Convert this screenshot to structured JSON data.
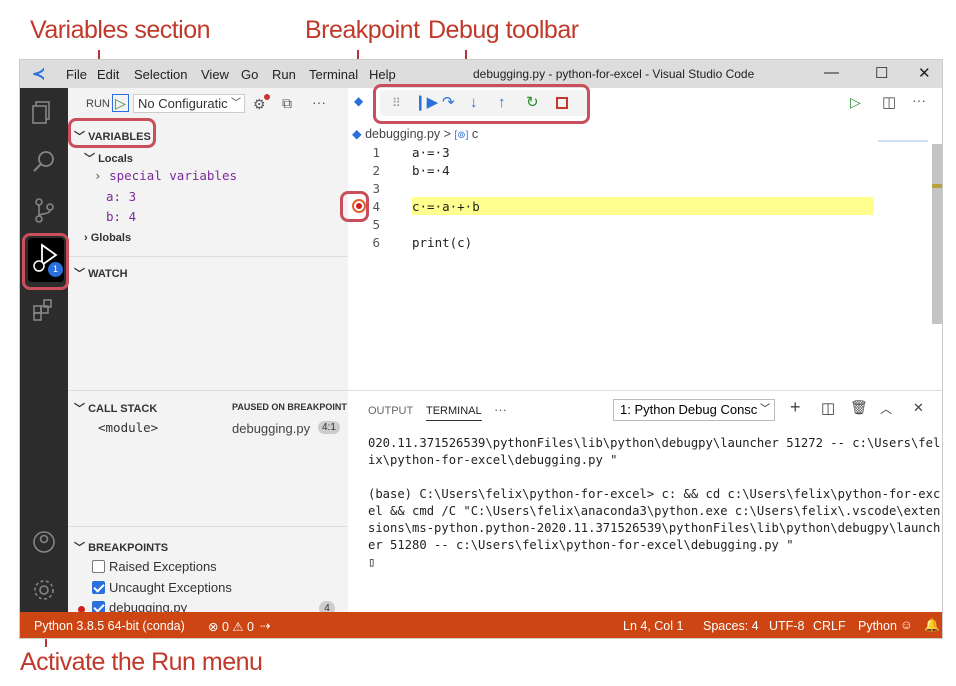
{
  "callouts": {
    "variables_section": "Variables section",
    "breakpoint": "Breakpoint",
    "debug_toolbar": "Debug toolbar",
    "activate_run": "Activate the Run menu"
  },
  "colors": {
    "accent": "#c9505a",
    "status_bar": "#cc4512",
    "highlight": "#ffff8f"
  },
  "titlebar": {
    "menu": [
      "File",
      "Edit",
      "Selection",
      "View",
      "Go",
      "Run",
      "Terminal",
      "Help"
    ],
    "title": "debugging.py - python-for-excel - Visual Studio Code",
    "minimize": "—",
    "maximize": "☐",
    "close": "✕"
  },
  "sidebar": {
    "run_label": "RUN",
    "config": "No Configuratic",
    "variables_header": "VARIABLES",
    "locals": "Locals",
    "special_variables": "special variables",
    "var_a": "a: 3",
    "var_b": "b: 4",
    "globals": "Globals",
    "watch_header": "WATCH",
    "call_stack_header": "CALL STACK",
    "paused": "PAUSED ON BREAKPOINT",
    "module": "<module>",
    "frame_file": "debugging.py",
    "frame_pos": "4:1",
    "breakpoints_header": "BREAKPOINTS",
    "bp_raised": "Raised Exceptions",
    "bp_uncaught": "Uncaught Exceptions",
    "bp_file": "debugging.py",
    "bp_count": "4",
    "debug_badge": "1"
  },
  "editor": {
    "breadcrumb_file": "debugging.py",
    "breadcrumb_sep": ">",
    "breadcrumb_symbol": "c",
    "lines": [
      {
        "num": "1",
        "code": "a·=·3"
      },
      {
        "num": "2",
        "code": "b·=·4"
      },
      {
        "num": "3",
        "code": ""
      },
      {
        "num": "4",
        "code": "c·=·a·+·b"
      },
      {
        "num": "5",
        "code": ""
      },
      {
        "num": "6",
        "code": "print(c)"
      }
    ]
  },
  "panel": {
    "tab_output": "OUTPUT",
    "tab_terminal": "TERMINAL",
    "more": "···",
    "terminal_select": "1: Python Debug Consc",
    "terminal_lines": [
      "020.11.371526539\\pythonFiles\\lib\\python\\debugpy\\launcher 51272 -- c:\\Users\\fel",
      "ix\\python-for-excel\\debugging.py \"",
      "",
      "(base) C:\\Users\\felix\\python-for-excel> c: && cd c:\\Users\\felix\\python-for-exc",
      "el && cmd /C \"C:\\Users\\felix\\anaconda3\\python.exe c:\\Users\\felix\\.vscode\\exten",
      "sions\\ms-python.python-2020.11.371526539\\pythonFiles\\lib\\python\\debugpy\\launch",
      "er 51280 -- c:\\Users\\felix\\python-for-excel\\debugging.py \"",
      "▯"
    ]
  },
  "statusbar": {
    "python": "Python 3.8.5 64-bit (conda)",
    "problems": "⊗ 0 ⚠ 0",
    "position": "Ln 4, Col 1",
    "spaces": "Spaces: 4",
    "encoding": "UTF-8",
    "eol": "CRLF",
    "language": "Python"
  }
}
